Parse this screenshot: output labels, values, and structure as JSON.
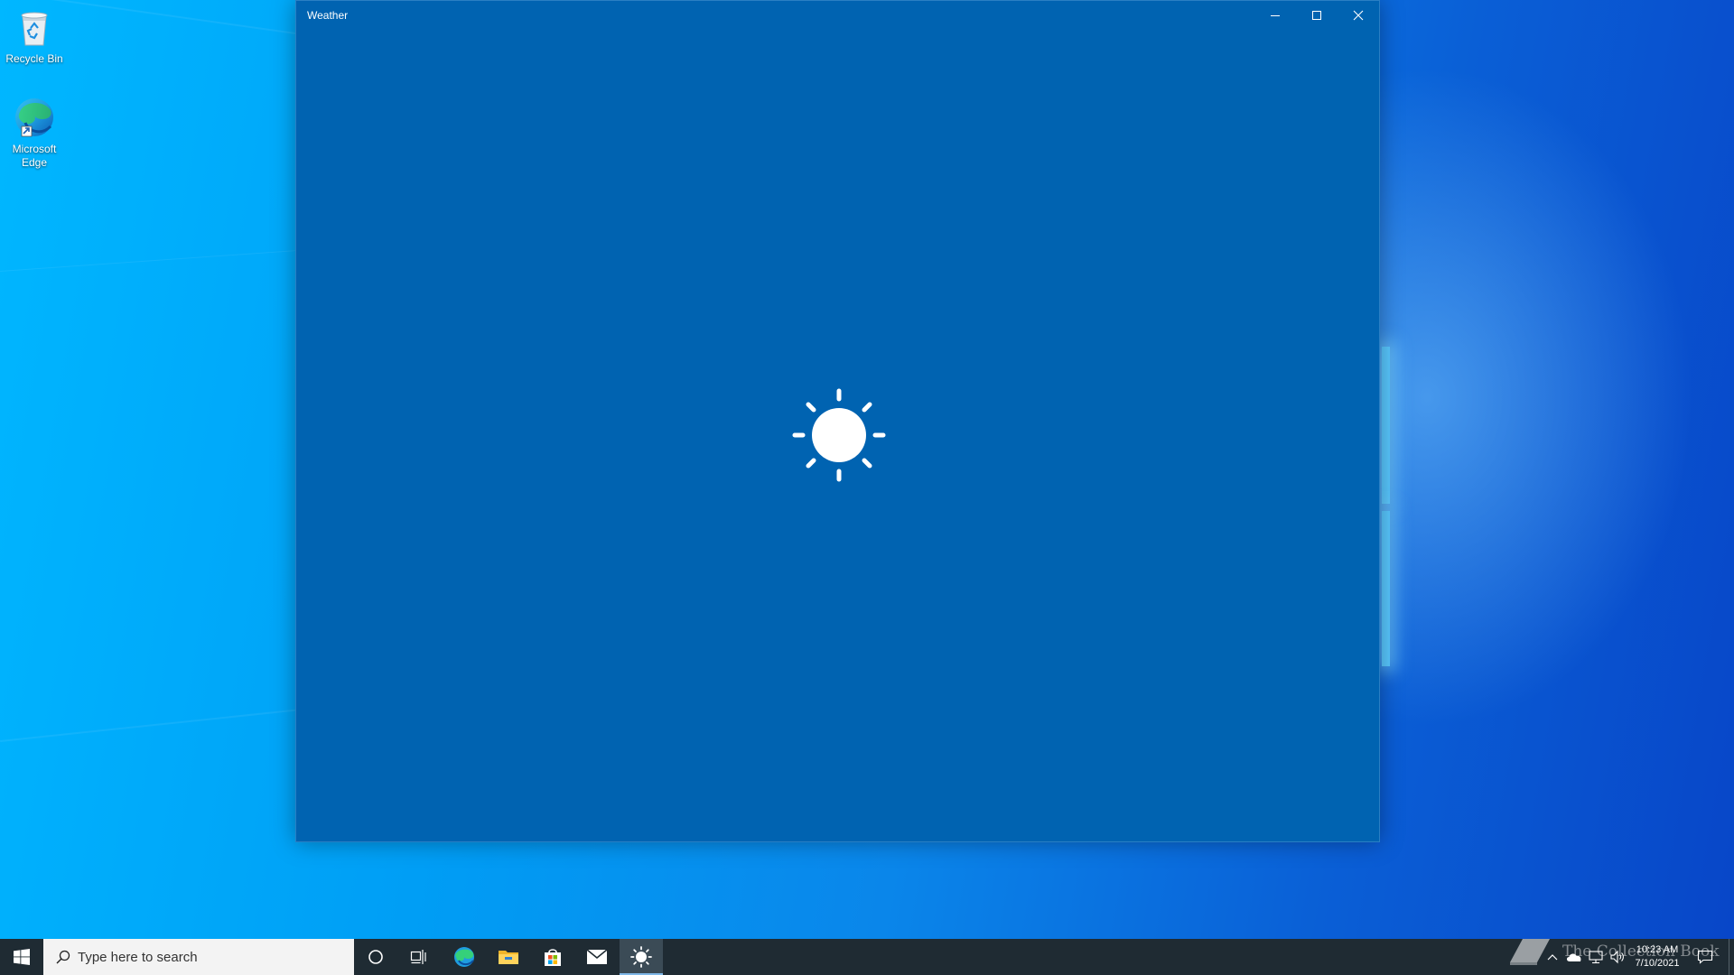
{
  "desktop": {
    "icons": [
      {
        "label": "Recycle Bin"
      },
      {
        "label": "Microsoft Edge"
      }
    ]
  },
  "window": {
    "title": "Weather",
    "background": "#0063b1",
    "splash_icon": "sun-icon",
    "controls": {
      "minimize": "minimize-icon",
      "maximize": "maximize-icon",
      "close": "close-icon"
    }
  },
  "taskbar": {
    "search": {
      "placeholder": "Type here to search"
    },
    "pinned": [
      "cortana-icon",
      "task-view-icon",
      "edge-icon",
      "file-explorer-icon",
      "store-icon",
      "mail-icon",
      "weather-icon"
    ],
    "active_app": "weather-icon",
    "tray": {
      "time": "10:23 AM",
      "date": "7/10/2021"
    }
  },
  "watermark": {
    "text": "The Collection Book"
  },
  "colors": {
    "taskbar": "#1f2b33",
    "window": "#0063b1",
    "accent": "#0078d7"
  }
}
